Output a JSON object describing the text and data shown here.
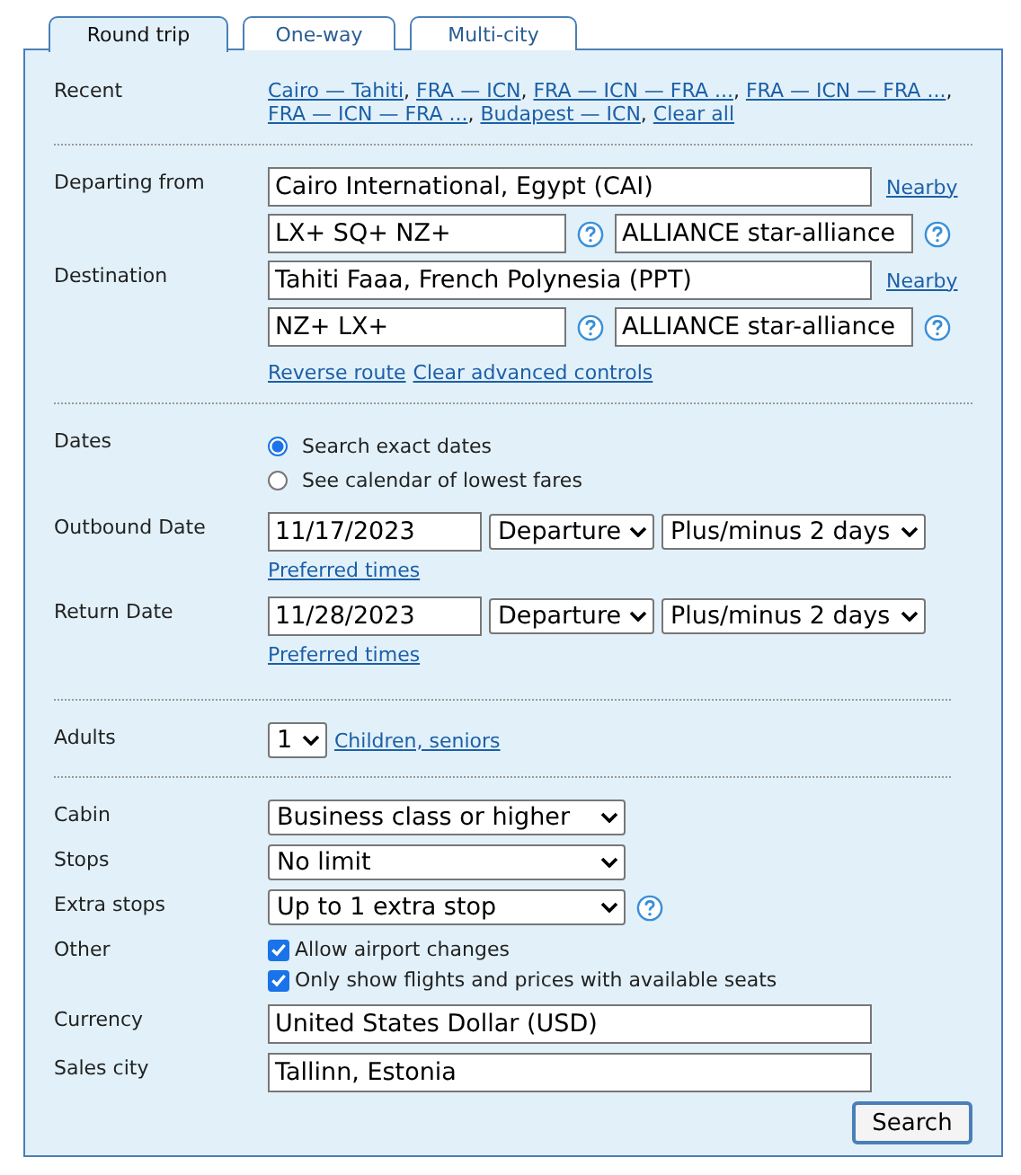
{
  "tabs": [
    {
      "label": "Round trip",
      "selected": true
    },
    {
      "label": "One-way",
      "selected": false
    },
    {
      "label": "Multi-city",
      "selected": false
    }
  ],
  "recent": {
    "label": "Recent",
    "items": [
      {
        "label": "Cairo — Tahiti",
        "separator": ","
      },
      {
        "label": "FRA — ICN",
        "separator": ","
      },
      {
        "label": "FRA — ICN — FRA ...",
        "separator": ","
      },
      {
        "label": "FRA — ICN — FRA ...",
        "separator": ","
      },
      {
        "label": "FRA — ICN — FRA ...",
        "separator": ","
      },
      {
        "label": "Budapest — ICN",
        "separator": ","
      },
      {
        "label": "Clear all"
      }
    ]
  },
  "route": [
    {
      "label": "Departing from",
      "airport": "Cairo International, Egypt (CAI)",
      "link": "Nearby",
      "carriers": "LX+ SQ+ NZ+",
      "alliance": "ALLIANCE star-alliance"
    },
    {
      "label": "Destination",
      "airport": "Tahiti Faaa, French Polynesia (PPT)",
      "link": "Nearby",
      "carriers": "NZ+ LX+",
      "alliance": "ALLIANCE star-alliance"
    }
  ],
  "route_links": [
    "Reverse route",
    "Clear advanced controls"
  ],
  "dates": {
    "label": "Dates",
    "options": [
      {
        "label": "Search exact dates",
        "selected": true
      },
      {
        "label": "See calendar of lowest fares",
        "selected": false
      }
    ]
  },
  "legs": [
    {
      "label": "Outbound Date",
      "date": "11/17/2023",
      "anchor": "Departure",
      "flex": "Plus/minus 2 days",
      "link": "Preferred times"
    },
    {
      "label": "Return Date",
      "date": "11/28/2023",
      "anchor": "Departure",
      "flex": "Plus/minus 2 days",
      "link": "Preferred times"
    }
  ],
  "adults": {
    "label": "Adults",
    "value": "1",
    "link": "Children, seniors"
  },
  "options": [
    {
      "label": "Cabin",
      "value": "Business class or higher",
      "help": false
    },
    {
      "label": "Stops",
      "value": "No limit",
      "help": false
    },
    {
      "label": "Extra stops",
      "value": "Up to 1 extra stop",
      "help": true
    }
  ],
  "other": {
    "label": "Other",
    "checkboxes": [
      {
        "label": "Allow airport changes",
        "checked": true
      },
      {
        "label": "Only show flights and prices with available seats",
        "checked": true
      }
    ]
  },
  "currency": {
    "label": "Currency",
    "value": "United States Dollar (USD)"
  },
  "sales_city": {
    "label": "Sales city",
    "value": "Tallinn, Estonia"
  },
  "search_button": "Search"
}
